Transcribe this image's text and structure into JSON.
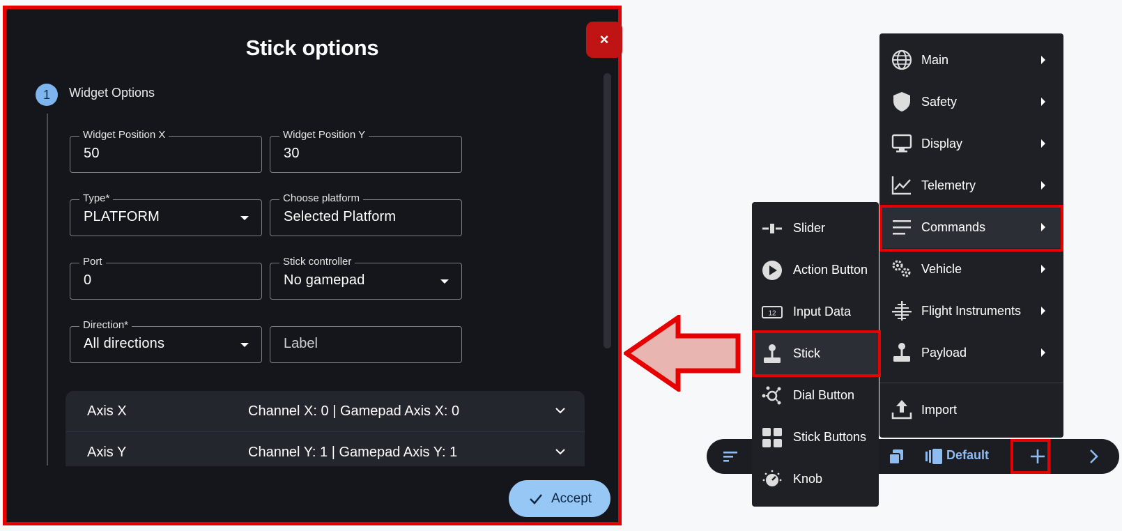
{
  "dialog": {
    "title": "Stick options",
    "close_label": "×",
    "step": {
      "number": "1",
      "label": "Widget Options"
    },
    "fields": {
      "pos_x": {
        "label": "Widget Position X",
        "value": "50"
      },
      "pos_y": {
        "label": "Widget Position Y",
        "value": "30"
      },
      "type": {
        "label": "Type*",
        "value": "PLATFORM"
      },
      "platform": {
        "label": "Choose platform",
        "value": "Selected Platform"
      },
      "port": {
        "label": "Port",
        "value": "0"
      },
      "controller": {
        "label": "Stick controller",
        "value": "No gamepad"
      },
      "direction": {
        "label": "Direction*",
        "value": "All directions"
      },
      "label_field": {
        "placeholder": "Label"
      }
    },
    "axes": [
      {
        "name": "Axis X",
        "info": "Channel X: 0 | Gamepad Axis X: 0"
      },
      {
        "name": "Axis Y",
        "info": "Channel Y: 1 | Gamepad Axis Y: 1"
      }
    ],
    "accept_label": "Accept"
  },
  "main_menu": {
    "items": [
      {
        "label": "Main",
        "icon": "globe-icon"
      },
      {
        "label": "Safety",
        "icon": "shield-icon"
      },
      {
        "label": "Display",
        "icon": "monitor-icon"
      },
      {
        "label": "Telemetry",
        "icon": "line-chart-icon"
      },
      {
        "label": "Commands",
        "icon": "menu-lines-icon"
      },
      {
        "label": "Vehicle",
        "icon": "gears-icon"
      },
      {
        "label": "Flight Instruments",
        "icon": "attitude-icon"
      },
      {
        "label": "Payload",
        "icon": "joystick-icon"
      }
    ],
    "import_label": "Import"
  },
  "sub_menu": {
    "items": [
      {
        "label": "Slider",
        "icon": "slider-icon"
      },
      {
        "label": "Action Button",
        "icon": "play-circle-icon"
      },
      {
        "label": "Input Data",
        "icon": "numeric-input-icon"
      },
      {
        "label": "Stick",
        "icon": "joystick-icon"
      },
      {
        "label": "Dial Button",
        "icon": "dial-icon"
      },
      {
        "label": "Stick Buttons",
        "icon": "grid-icon"
      },
      {
        "label": "Knob",
        "icon": "knob-icon"
      }
    ]
  },
  "bottom_bar": {
    "profile_label": "Default"
  },
  "colors": {
    "highlight": "#e60000",
    "accent": "#97c7f4",
    "danger": "#c01414",
    "panel": "#14161b"
  }
}
